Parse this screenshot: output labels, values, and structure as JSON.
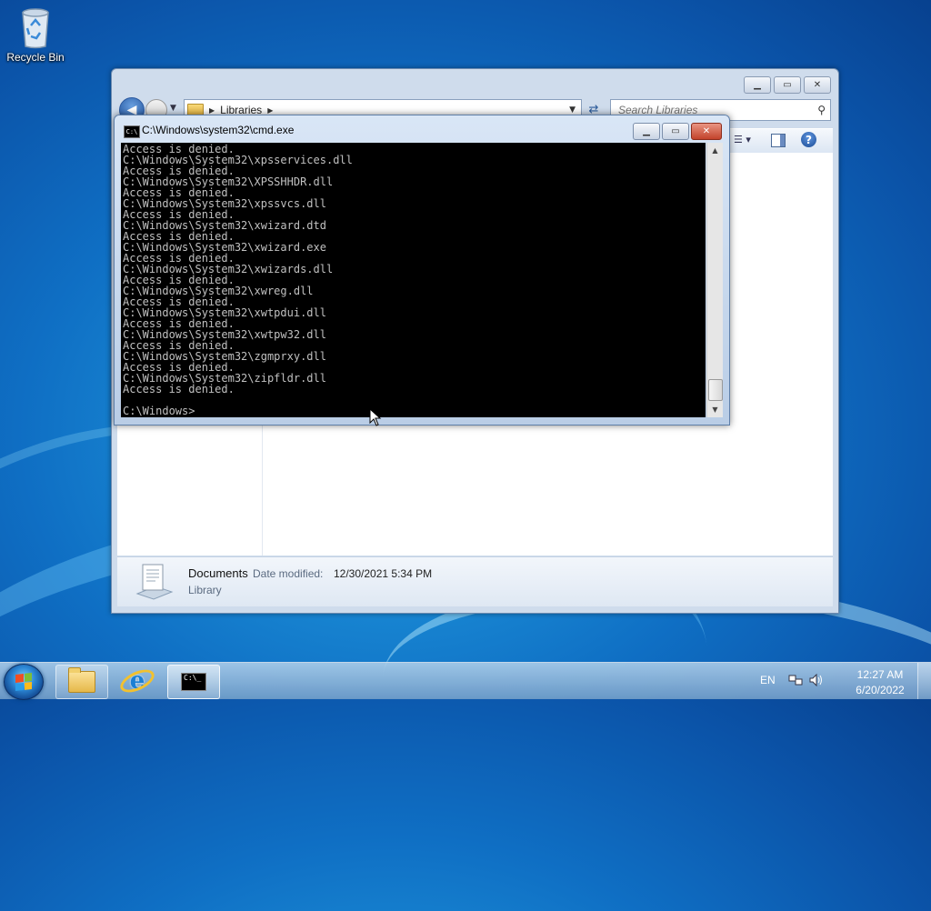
{
  "desktop": {
    "icons": [
      {
        "label": "Recycle Bin"
      }
    ]
  },
  "explorer": {
    "address": {
      "path": "Libraries"
    },
    "search": {
      "placeholder": "Search Libraries"
    },
    "details": {
      "name": "Documents",
      "modified_label": "Date modified:",
      "modified_value": "12/30/2021 5:34 PM",
      "type": "Library"
    }
  },
  "cmd": {
    "title": "C:\\Windows\\system32\\cmd.exe",
    "output_lines": [
      "Access is denied.",
      "C:\\Windows\\System32\\xpsservices.dll",
      "Access is denied.",
      "C:\\Windows\\System32\\XPSSHHDR.dll",
      "Access is denied.",
      "C:\\Windows\\System32\\xpssvcs.dll",
      "Access is denied.",
      "C:\\Windows\\System32\\xwizard.dtd",
      "Access is denied.",
      "C:\\Windows\\System32\\xwizard.exe",
      "Access is denied.",
      "C:\\Windows\\System32\\xwizards.dll",
      "Access is denied.",
      "C:\\Windows\\System32\\xwreg.dll",
      "Access is denied.",
      "C:\\Windows\\System32\\xwtpdui.dll",
      "Access is denied.",
      "C:\\Windows\\System32\\xwtpw32.dll",
      "Access is denied.",
      "C:\\Windows\\System32\\zgmprxy.dll",
      "Access is denied.",
      "C:\\Windows\\System32\\zipfldr.dll",
      "Access is denied."
    ],
    "prompt": "C:\\Windows>"
  },
  "taskbar": {
    "icons": [
      "start-orb-icon",
      "folder-icon",
      "internet-explorer-icon",
      "command-prompt-icon"
    ],
    "language": "EN",
    "clock": {
      "time": "12:27 AM",
      "date": "6/20/2022"
    }
  },
  "colors": {
    "console_bg": "#000000",
    "console_text": "#c0c0c0",
    "desktop_blue": "#0f6fc4"
  }
}
